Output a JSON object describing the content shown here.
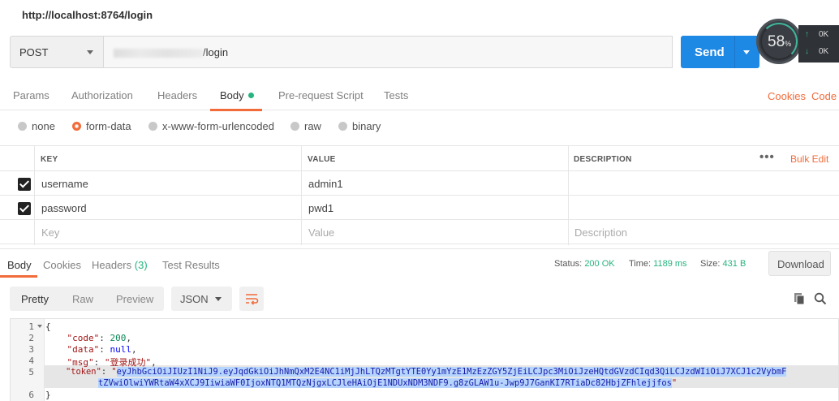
{
  "title_url": "http://localhost:8764/login",
  "request": {
    "method": "POST",
    "url_suffix": "/login",
    "send_label": "Send"
  },
  "monitor": {
    "gauge_value": "58",
    "gauge_unit": "%",
    "up": "0K",
    "down": "0K"
  },
  "tabs": {
    "params": "Params",
    "authorization": "Authorization",
    "headers": "Headers",
    "body": "Body",
    "prerequest": "Pre-request Script",
    "tests": "Tests",
    "cookies": "Cookies",
    "code": "Code"
  },
  "body_types": {
    "none": "none",
    "form_data": "form-data",
    "urlencoded": "x-www-form-urlencoded",
    "raw": "raw",
    "binary": "binary"
  },
  "kv_table": {
    "headers": [
      "KEY",
      "VALUE",
      "DESCRIPTION"
    ],
    "bulk_edit": "Bulk Edit",
    "rows": [
      {
        "key": "username",
        "value": "admin1",
        "description": ""
      },
      {
        "key": "password",
        "value": "pwd1",
        "description": ""
      }
    ],
    "placeholder": {
      "key": "Key",
      "value": "Value",
      "description": "Description"
    }
  },
  "response": {
    "tabs": {
      "body": "Body",
      "cookies": "Cookies",
      "headers": "Headers",
      "headers_count": "(3)",
      "test_results": "Test Results"
    },
    "status_label": "Status:",
    "status_value": "200 OK",
    "time_label": "Time:",
    "time_value": "1189 ms",
    "size_label": "Size:",
    "size_value": "431 B",
    "download": "Download",
    "views": {
      "pretty": "Pretty",
      "raw": "Raw",
      "preview": "Preview"
    },
    "format": "JSON"
  },
  "code_lines": {
    "l1": "{",
    "l2_key": "\"code\"",
    "l2_val": "200",
    "l3_key": "\"data\"",
    "l3_val": "null",
    "l4_key": "\"msg\"",
    "l4_val": "\"登录成功\"",
    "l5_key": "\"token\"",
    "l5_val_a": "eyJhbGciOiJIUzI1NiJ9.eyJqdGkiOiJhNmQxM2E4NC1iMjJhLTQzMTgtYTE0Yy1mYzE1MzEzZGY5ZjEiLCJpc3MiOiJzeHQtdGVzdCIqd3QiLCJzdWIiOiJ7XCJ1c2VybmF",
    "l5_val_b": "tZVwiOlwiYWRtaW4xXCJ9IiwiaWF0IjoxNTQ1MTQzNjgxLCJleHAiOjE1NDUxNDM3NDF9.g8zGLAW1u-Jwp9J7GanKI7RTiaDc82HbjZFhlejjfos",
    "l6": "}"
  }
}
